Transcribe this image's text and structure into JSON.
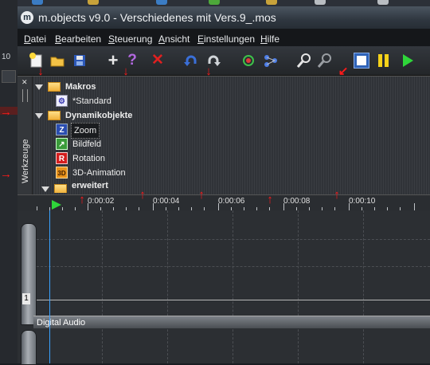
{
  "window": {
    "title": "m.objects v9.0 - Verschiedenes mit Vers.9_.mos"
  },
  "desktop": {
    "number": "10"
  },
  "menu": {
    "datei": "Datei",
    "bearbeiten": "Bearbeiten",
    "steuerung": "Steuerung",
    "ansicht": "Ansicht",
    "einstellungen": "Einstellungen",
    "hilfe": "Hilfe"
  },
  "toolbar": {
    "icons": [
      "new-icon",
      "open-icon",
      "save-icon",
      "add-icon",
      "help-icon",
      "delete-icon",
      "undo-icon",
      "redo-icon",
      "node-icon",
      "network-icon",
      "zoom-in-icon",
      "zoom-out-icon",
      "stop-icon",
      "pause-icon",
      "play-icon"
    ],
    "colors": {
      "stop": "#ffffff",
      "pause": "#f5d21a",
      "play": "#2fd63a",
      "delete": "#e02020",
      "undo": "#3a6fd8"
    }
  },
  "tools_panel": {
    "side_label": "Werkzeuge",
    "makros": {
      "label": "Makros",
      "items": [
        {
          "label": "*Standard",
          "icon": "macro-icon"
        }
      ]
    },
    "dynamikobjekte": {
      "label": "Dynamikobjekte",
      "items": [
        {
          "label": "Zoom",
          "icon": "zoom-letter-icon",
          "glyph": "Z",
          "selected": true
        },
        {
          "label": "Bildfeld",
          "icon": "image-field-icon",
          "glyph": "↗"
        },
        {
          "label": "Rotation",
          "icon": "rotation-letter-icon",
          "glyph": "R"
        },
        {
          "label": "3D-Animation",
          "icon": "animation-3d-icon",
          "glyph": "3D"
        }
      ]
    },
    "erweitert": {
      "label": "erweitert"
    }
  },
  "ruler": {
    "labels": [
      "0:00:02",
      "0:00:04",
      "0:00:06",
      "0:00:08",
      "0:00:10"
    ]
  },
  "timeline": {
    "track_number": "1",
    "audio_track_label": "Digital Audio"
  },
  "annotation": {
    "arrow_color": "#ff1a1a"
  }
}
